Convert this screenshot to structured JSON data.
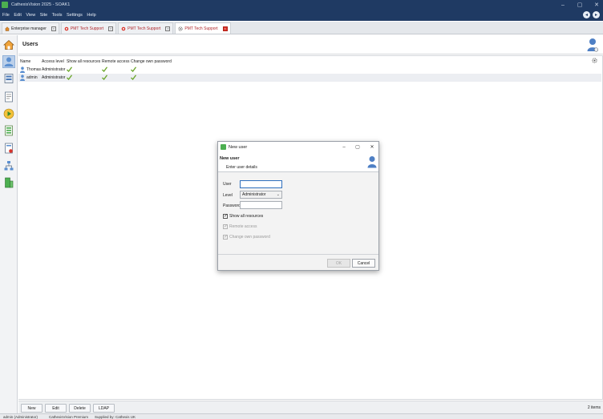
{
  "window": {
    "title": "CathexisVision 2025 - SOAK1",
    "accent_color": "#1f3a63"
  },
  "menu": {
    "items": [
      "File",
      "Edit",
      "View",
      "Site",
      "Tools",
      "Settings",
      "Help"
    ]
  },
  "tabs": [
    {
      "label": "Enterprise manager",
      "active": false
    },
    {
      "label": "PMT Tech Support",
      "active": false
    },
    {
      "label": "PMT Tech Support",
      "active": false
    },
    {
      "label": "PMT Tech Support",
      "active": true
    }
  ],
  "main": {
    "title": "Users",
    "columns": [
      "Name",
      "Access level",
      "Show all resources",
      "Remote access",
      "Change own password"
    ],
    "rows": [
      {
        "name": "Thomas",
        "access_level": "Administrator",
        "show_all": true,
        "remote": true,
        "change_pw": true
      },
      {
        "name": "admin",
        "access_level": "Administrator",
        "show_all": true,
        "remote": true,
        "change_pw": true
      }
    ],
    "buttons": {
      "new": "New",
      "edit": "Edit",
      "delete": "Delete",
      "ldap": "LDAP"
    },
    "items_count": "2 items"
  },
  "statusbar": {
    "user": "admin (Administrator)",
    "product": "CathexisVision Premium",
    "supplied": "Supplied by: Cathexis UK"
  },
  "dialog": {
    "window_title": "New user",
    "heading": "New user",
    "subheading": "Enter user details",
    "fields": {
      "user_label": "User",
      "user_value": "",
      "level_label": "Level",
      "level_value": "Administrator",
      "password_label": "Password",
      "password_value": ""
    },
    "checkboxes": {
      "show_all": {
        "label": "Show all resources",
        "checked": true,
        "enabled": true
      },
      "remote": {
        "label": "Remote access",
        "checked": true,
        "enabled": false
      },
      "change_pw": {
        "label": "Change own password",
        "checked": true,
        "enabled": false
      }
    },
    "ok_label": "OK",
    "cancel_label": "Cancel"
  }
}
